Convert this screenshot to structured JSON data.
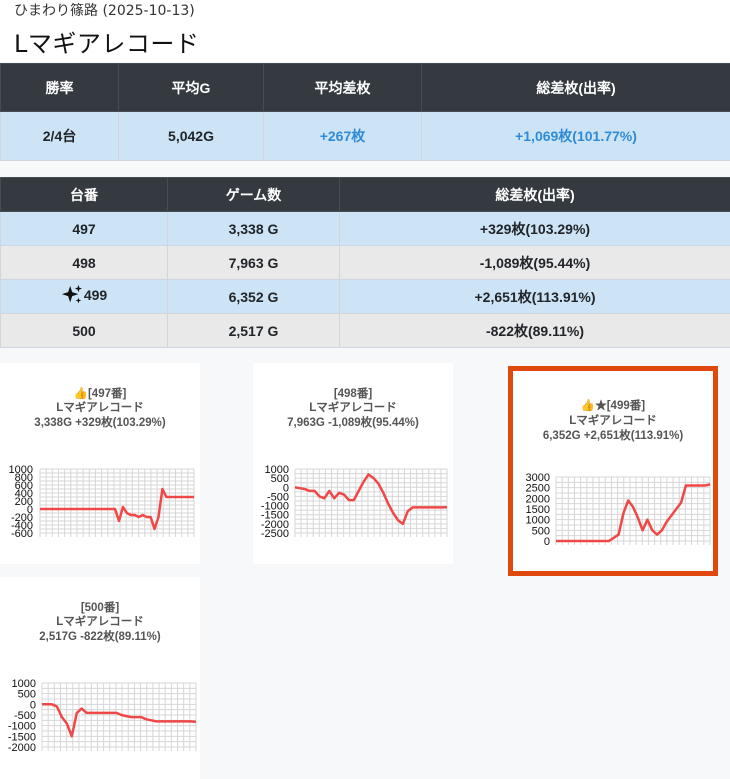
{
  "header": {
    "subtitle": "ひまわり篠路 (2025-10-13)",
    "title": "Lマギアレコード"
  },
  "summary": {
    "headers": [
      "勝率",
      "平均G",
      "平均差枚",
      "総差枚(出率)"
    ],
    "values": [
      "2/4台",
      "5,042G",
      "+267枚",
      "+1,069枚(101.77%)"
    ]
  },
  "machines": {
    "headers": [
      "台番",
      "ゲーム数",
      "総差枚(出率)"
    ],
    "rows": [
      {
        "number": "497",
        "games": "3,338 G",
        "diff": "+329枚(103.29%)"
      },
      {
        "number": "498",
        "games": "7,963 G",
        "diff": "-1,089枚(95.44%)"
      },
      {
        "number": "499",
        "games": "6,352 G",
        "diff": "+2,651枚(113.91%)"
      },
      {
        "number": "500",
        "games": "2,517 G",
        "diff": "-822枚(89.11%)"
      }
    ]
  },
  "colors": {
    "line": "#f04747",
    "highlight_border": "#e0490e",
    "table_header": "#343a40",
    "positive_text": "#2f8bd6"
  },
  "chart_data": [
    {
      "type": "line",
      "title": "👍[497番]",
      "machine_name": "Lマギアレコード",
      "stats": "3,338G +329枚(103.29%)",
      "yticks": [
        1000,
        800,
        600,
        400,
        200,
        0,
        -200,
        -400,
        -600
      ],
      "ylim": [
        -600,
        1000
      ],
      "values": [
        0,
        0,
        0,
        0,
        0,
        0,
        0,
        0,
        0,
        0,
        0,
        0,
        0,
        0,
        0,
        0,
        0,
        0,
        0,
        0,
        -300,
        50,
        -100,
        -150,
        -150,
        -200,
        -150,
        -200,
        -200,
        -500,
        -200,
        500,
        300,
        300,
        300,
        300,
        300,
        300,
        300,
        300
      ]
    },
    {
      "type": "line",
      "title": "[498番]",
      "machine_name": "Lマギアレコード",
      "stats": "7,963G -1,089枚(95.44%)",
      "yticks": [
        1000,
        500,
        0,
        -500,
        -1000,
        -1500,
        -2000,
        -2500
      ],
      "ylim": [
        -2500,
        1000
      ],
      "values": [
        0,
        -50,
        -100,
        -200,
        -200,
        -500,
        -600,
        -200,
        -600,
        -300,
        -400,
        -700,
        -700,
        -200,
        300,
        700,
        500,
        200,
        -300,
        -900,
        -1400,
        -1800,
        -2000,
        -1300,
        -1100,
        -1100,
        -1100,
        -1100,
        -1100,
        -1100,
        -1100,
        -1089
      ]
    },
    {
      "type": "line",
      "title": "👍★[499番]",
      "machine_name": "Lマギアレコード",
      "stats": "6,352G +2,651枚(113.91%)",
      "yticks": [
        3000,
        2500,
        2000,
        1500,
        1000,
        500,
        0
      ],
      "ylim": [
        0,
        3000
      ],
      "values": [
        0,
        0,
        0,
        0,
        0,
        0,
        0,
        0,
        0,
        0,
        0,
        0,
        150,
        300,
        1300,
        1900,
        1600,
        1100,
        500,
        1000,
        500,
        300,
        500,
        900,
        1200,
        1500,
        1800,
        2600,
        2600,
        2600,
        2600,
        2600,
        2651
      ]
    },
    {
      "type": "line",
      "title": "[500番]",
      "machine_name": "Lマギアレコード",
      "stats": "2,517G -822枚(89.11%)",
      "yticks": [
        1000,
        500,
        0,
        -500,
        -1000,
        -1500,
        -2000
      ],
      "ylim": [
        -2000,
        1000
      ],
      "values": [
        0,
        0,
        0,
        -100,
        -600,
        -900,
        -1500,
        -400,
        -200,
        -400,
        -400,
        -400,
        -400,
        -400,
        -400,
        -400,
        -500,
        -550,
        -600,
        -600,
        -600,
        -700,
        -750,
        -800,
        -800,
        -800,
        -800,
        -800,
        -800,
        -800,
        -800,
        -822
      ]
    }
  ]
}
